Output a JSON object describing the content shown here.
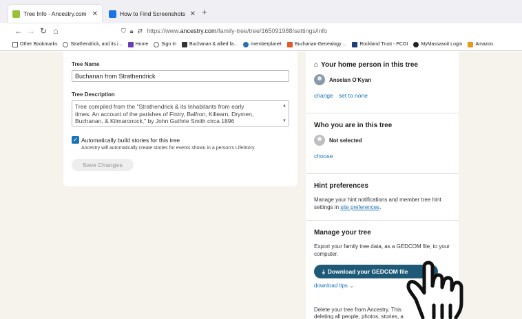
{
  "browser": {
    "tabs": [
      {
        "title": "Tree Info - Ancestry.com",
        "active": true,
        "favicon_color": "#9bbf3b"
      },
      {
        "title": "How to Find Screenshots on a Wi",
        "active": false,
        "favicon_color": "#1a73e8"
      }
    ],
    "url": {
      "prefix": "https://www.",
      "domain": "ancestry.com",
      "path": "/family-tree/tree/165091988/settings/info"
    },
    "bookmarks": [
      {
        "label": "Other Bookmarks",
        "color": "#555"
      },
      {
        "label": "Strathendrick, and its i...",
        "color": "#666"
      },
      {
        "label": "Home",
        "color": "#6a3fb5"
      },
      {
        "label": "Sign In",
        "color": "#666"
      },
      {
        "label": "Buchanan & allied fa...",
        "color": "#333"
      },
      {
        "label": "memberplanet",
        "color": "#2a6fb0"
      },
      {
        "label": "Buchanan-Genealogy ...",
        "color": "#e2592b"
      },
      {
        "label": "Rockland Trust - PCGI",
        "color": "#1d3f7a"
      },
      {
        "label": "MyMassasoit Login",
        "color": "#222"
      },
      {
        "label": "Amazon.",
        "color": "#e39b1b"
      }
    ]
  },
  "form": {
    "tree_name_label": "Tree Name",
    "tree_name_value": "Buchanan from Strathendrick",
    "tree_desc_label": "Tree Description",
    "tree_desc_line1": "Tree compiled from the \"Strathendrick & its Inhabitants from early",
    "tree_desc_line2": "times.  An account of the parishes of Fintry, Balfron, Killearn, Drymen,",
    "tree_desc_line3": "Buchanan, & Kilmaronock,\" by John Guthrie Smith circa 1896",
    "auto_stories_label": "Automatically build stories for this tree",
    "auto_stories_sub": "Ancestry will automatically create stories for events shown in a person's LifeStory.",
    "save_label": "Save Changes"
  },
  "sidebar": {
    "home_person": {
      "title": "Your home person in this tree",
      "name": "Anselan O'Kyan",
      "change": "change",
      "set_none": "set to none"
    },
    "who_you_are": {
      "title": "Who you are in this tree",
      "name": "Not selected",
      "choose": "choose"
    },
    "hints": {
      "title": "Hint preferences",
      "text": "Manage your hint notifications and member tree hint settings in",
      "link": "site preferences",
      "period": "."
    },
    "manage": {
      "title": "Manage your tree",
      "text": "Export your family tree data, as a GEDCOM file, to your computer.",
      "download_label": "Download your GEDCOM file",
      "tips": "download tips",
      "delete_line1": "Delete your tree from Ancestry. This",
      "delete_line2": "deleting all people, photos, stories, a"
    }
  },
  "colors": {
    "accent": "#1a73b5",
    "download_button": "#1e5a78",
    "page_bg": "#f6f2ec"
  }
}
